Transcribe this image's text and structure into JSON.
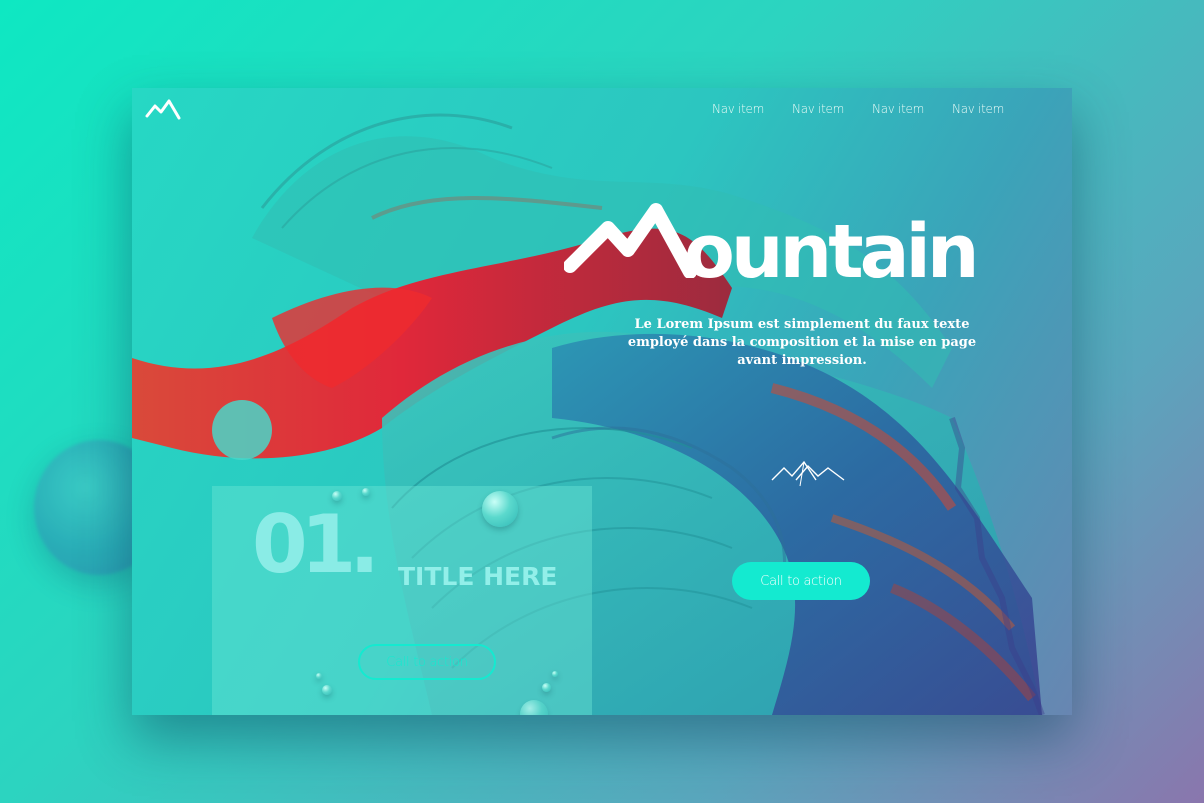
{
  "nav": {
    "items": [
      "Nav item",
      "Nav item",
      "Nav item",
      "Nav item"
    ]
  },
  "hero": {
    "brand_word": "ountain",
    "tagline": "Le Lorem Ipsum est simplement du faux texte employé dans la composition et la mise en page avant impression.",
    "cta_label": "Call to action"
  },
  "panel": {
    "number": "01.",
    "title": "TITLE HERE",
    "cta_label": "Call to action"
  },
  "icons": [
    "mountain-logo-icon",
    "mountain-m-icon",
    "mini-mountain-icon"
  ],
  "colors": {
    "accent": "#14ead0",
    "background_start": "#0ee8c2",
    "background_end": "#8a76ad",
    "art_red": "#d8333a",
    "art_blue": "#2f5aa8"
  }
}
